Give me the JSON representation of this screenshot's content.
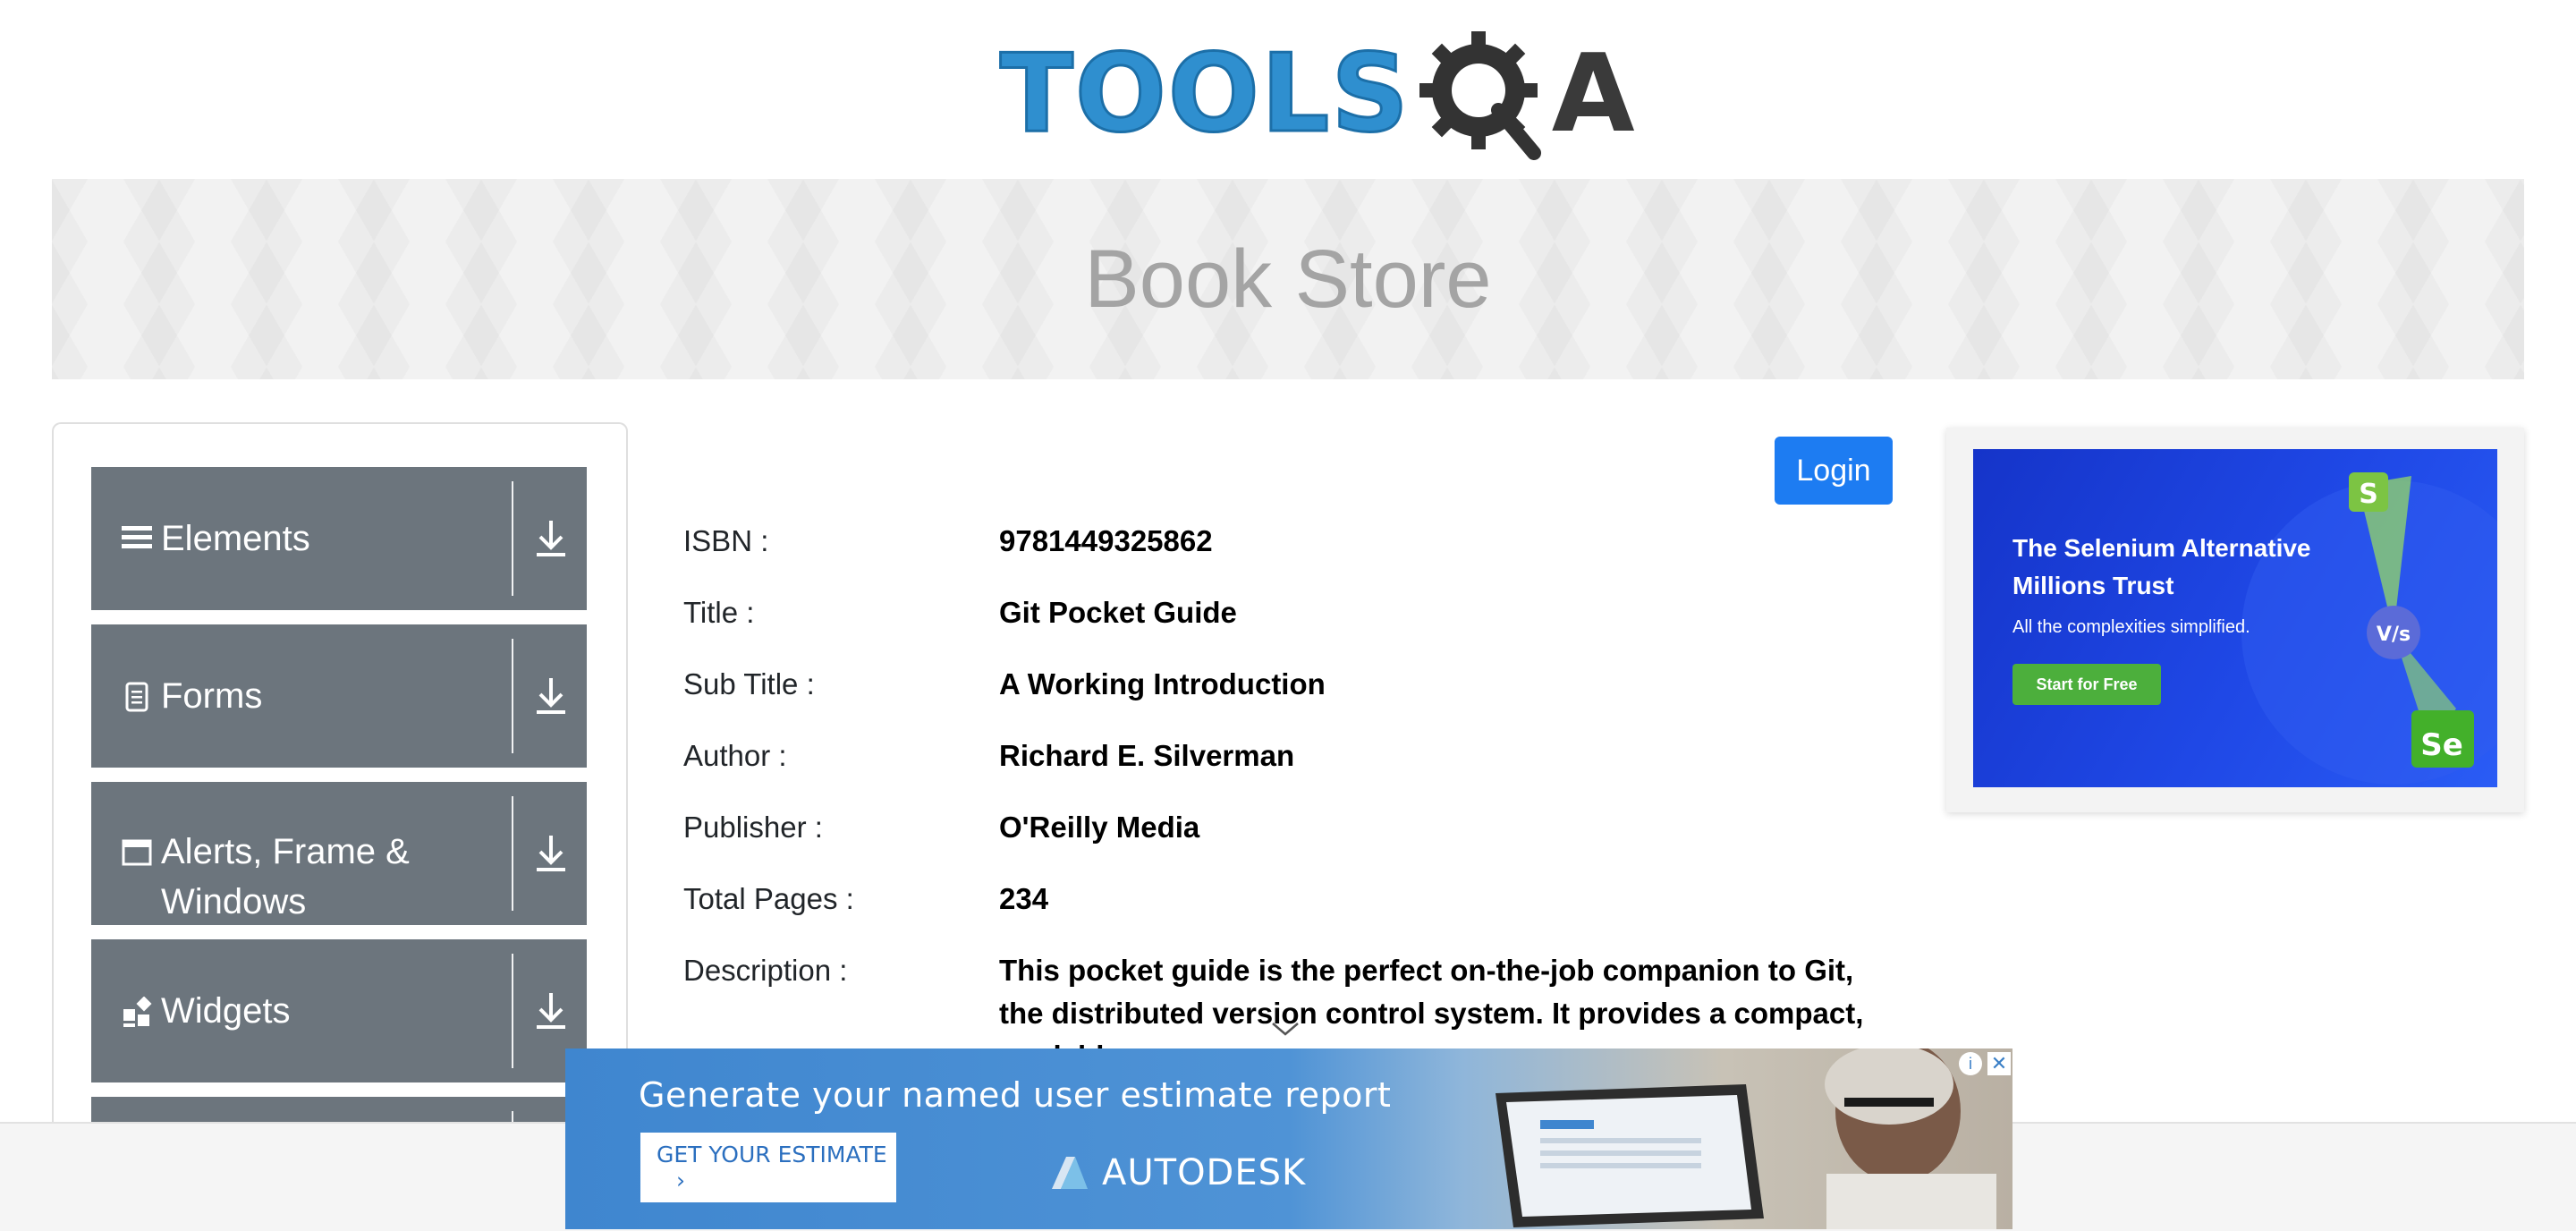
{
  "header": {
    "logo_main": "TOOLS",
    "logo_a": "A"
  },
  "banner": {
    "title": "Book Store"
  },
  "sidebar": {
    "groups": [
      {
        "label": "Elements",
        "icon": "menu-icon"
      },
      {
        "label": "Forms",
        "icon": "document-icon"
      },
      {
        "label": "Alerts, Frame & Windows",
        "icon": "window-icon"
      },
      {
        "label": "Widgets",
        "icon": "widgets-icon"
      }
    ]
  },
  "toolbar": {
    "login_label": "Login"
  },
  "book": {
    "isbn_label": "ISBN :",
    "isbn": "9781449325862",
    "title_label": "Title :",
    "title": "Git Pocket Guide",
    "subtitle_label": "Sub Title :",
    "subtitle": "A Working Introduction",
    "author_label": "Author :",
    "author": "Richard E. Silverman",
    "publisher_label": "Publisher :",
    "publisher": "O'Reilly Media",
    "pages_label": "Total Pages :",
    "pages": "234",
    "description_label": "Description :",
    "description": "This pocket guide is the perfect on-the-job companion to Git, the distributed version control system. It provides a compact, readable"
  },
  "ad_right": {
    "title": "The Selenium Alternative Millions Trust",
    "subtitle": "All the complexities simplified.",
    "cta": "Start for Free",
    "colors": {
      "background": "#1f48e6",
      "cta": "#4caf3c"
    }
  },
  "ad_bottom": {
    "headline": "Generate your named user estimate report",
    "cta": "GET YOUR ESTIMATE",
    "cta_arrow": "›",
    "brand": "AUTODESK",
    "close": "✕",
    "info": "i"
  },
  "colors": {
    "primary": "#1d7cf2",
    "sidebar": "#6c757d",
    "logo_blue": "#2f8fcf"
  }
}
